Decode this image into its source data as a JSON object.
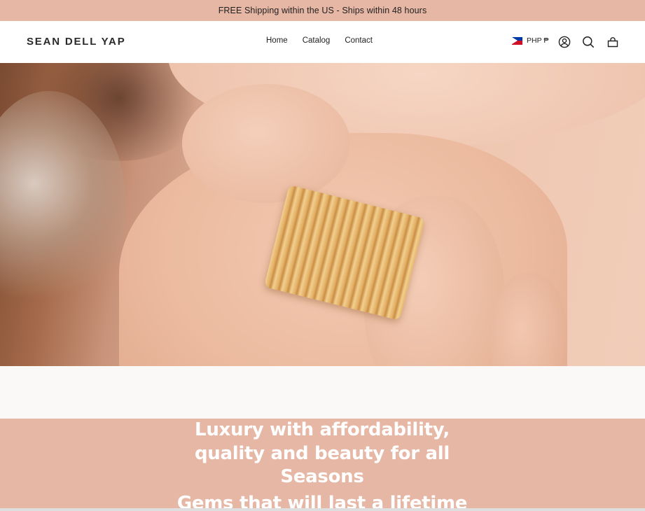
{
  "announcement": {
    "text": "FREE Shipping within the US - Ships within 48 hours"
  },
  "header": {
    "logo": "SEAN DELL YAP",
    "nav": [
      {
        "label": "Home"
      },
      {
        "label": "Catalog"
      },
      {
        "label": "Contact"
      }
    ],
    "currency": {
      "label": "PHP ₱",
      "flag": "philippines-flag-icon"
    },
    "icons": [
      "account-icon",
      "search-icon",
      "cart-icon"
    ]
  },
  "hero": {
    "image": "hand-with-gold-ring-photo"
  },
  "banner": {
    "heading": "Luxury with affordability, quality and beauty for all Seasons",
    "subheading": "Gems that will last a lifetime"
  },
  "colors": {
    "announcement_bg": "#e7b7a6",
    "banner_bg": "#e7b7a6",
    "header_bg": "#ffffff",
    "spacer_bg": "#faf9f7"
  }
}
